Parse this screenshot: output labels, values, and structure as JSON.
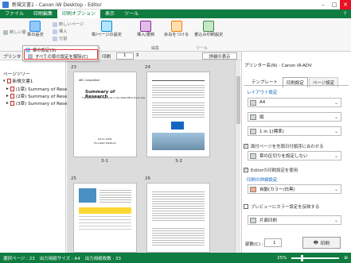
{
  "window": {
    "title": "新規文書1 - Canon iW Desktop - Editor"
  },
  "menubar": {
    "items": [
      "ファイル",
      "印刷編集",
      "印刷オプション",
      "表示",
      "ツール"
    ]
  },
  "ribbon": {
    "new_layer": "新しい層",
    "chapter_settings": "章の設定",
    "new_chapter": "新しいページ",
    "insert": "挿入",
    "split": "分割",
    "page_settings": "章/ページの設定",
    "insert_page": "挿入/更新",
    "page_assign": "余白をつける",
    "print_settings": "書込み印刷設定",
    "group_edit": "編集",
    "group_tools": "ツール"
  },
  "dropdown_menu": {
    "item1": "章の設定(S)",
    "item2": "すべての章の設定を解除(C)"
  },
  "toolbar2": {
    "printer_label": "プリンタ",
    "print_label": "印刷",
    "page_value": "1",
    "reset_label": "詳細の表示"
  },
  "left_panel": {
    "title": "ページツリー",
    "root": "新規文書1",
    "items": [
      "(1章) Summary of Rese",
      "(2章) Summary of Rese",
      "(3章) Summary of Rese"
    ]
  },
  "pages": [
    {
      "number": "23",
      "label": "3-1"
    },
    {
      "number": "24",
      "label": "3-2"
    },
    {
      "number": "25",
      "label": ""
    },
    {
      "number": "26",
      "label": ""
    }
  ],
  "page_text": {
    "company": "ABC Corporation",
    "report_title": "Summary of Research",
    "report_subtitle": "The General Improvements in the 2009 Office Fiscal Year",
    "date": "04-11-2009",
    "author": "Hyouzaki Takafumi"
  },
  "right_panel": {
    "printer": "プリンター名(N) : Canon iR-ADV",
    "tabs": [
      "テンプレート",
      "印刷設定",
      "ページ設定"
    ],
    "section": "レイアウト設定",
    "paper": "A4",
    "orientation": "縦",
    "pages_per_sheet": "1 in 1(標準)",
    "opt1": "面付ページを先頭日付順序に合わせる",
    "opt2": "章の区切りを設定しない",
    "opt3": "Editorの印刷設定を使用",
    "section2": "印刷の詳細設定",
    "color": "自動(カラー/白黒)",
    "preview": "プレビューにカラー設定を反映する",
    "duplex": "片面印刷",
    "copies_label": "部数(C) :",
    "copies": "1",
    "print_button": "印刷"
  },
  "statusbar": {
    "selected": "選択ページ : 23",
    "paper": "出力用紙サイズ : A4",
    "count": "出力用紙枚数 : 33",
    "zoom": "25%"
  },
  "colors": {
    "accent": "#107c41",
    "highlight": "#e53935"
  }
}
